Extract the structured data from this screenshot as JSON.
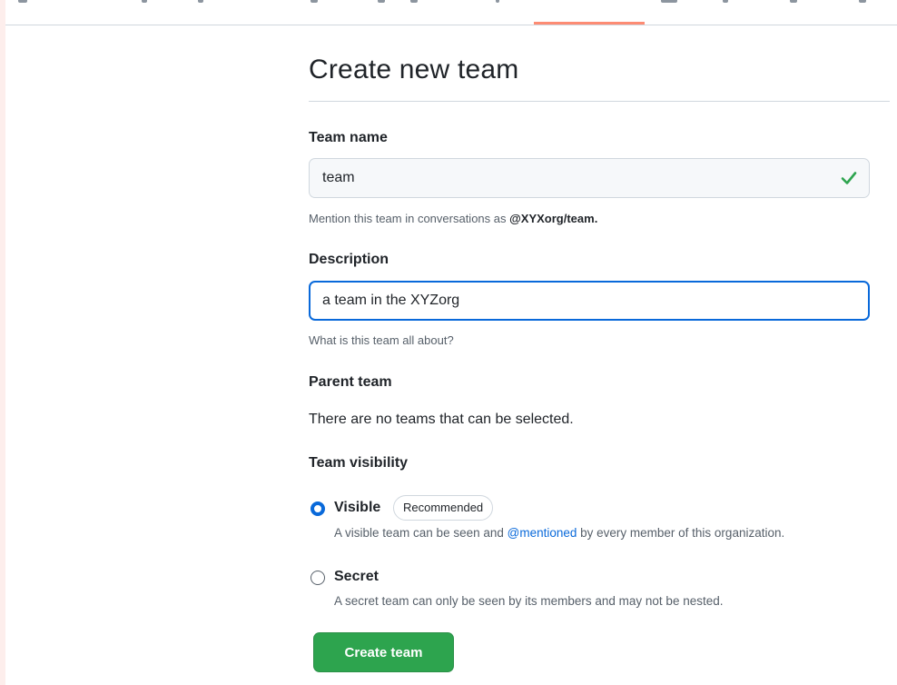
{
  "page": {
    "title": "Create new team"
  },
  "form": {
    "team_name": {
      "label": "Team name",
      "value": "team",
      "hint_prefix": "Mention this team in conversations as ",
      "hint_handle": "@XYXorg/team."
    },
    "description": {
      "label": "Description",
      "value": "a team in the XYZorg",
      "hint": "What is this team all about?"
    },
    "parent_team": {
      "label": "Parent team",
      "message": "There are no teams that can be selected."
    },
    "visibility": {
      "label": "Team visibility",
      "options": [
        {
          "label": "Visible",
          "badge": "Recommended",
          "desc_prefix": "A visible team can be seen and ",
          "desc_link": "@mentioned",
          "desc_suffix": " by every member of this organization.",
          "selected": true
        },
        {
          "label": "Secret",
          "desc": "A secret team can only be seen by its members and may not be nested.",
          "selected": false
        }
      ]
    },
    "submit_label": "Create team"
  },
  "icons": {
    "team_name_status": "check-icon"
  },
  "colors": {
    "accent": "#0969da",
    "primary_button": "#2da44e",
    "success": "#2da44e",
    "selected_tab": "#fd8c73",
    "background": "#fdeeec"
  }
}
